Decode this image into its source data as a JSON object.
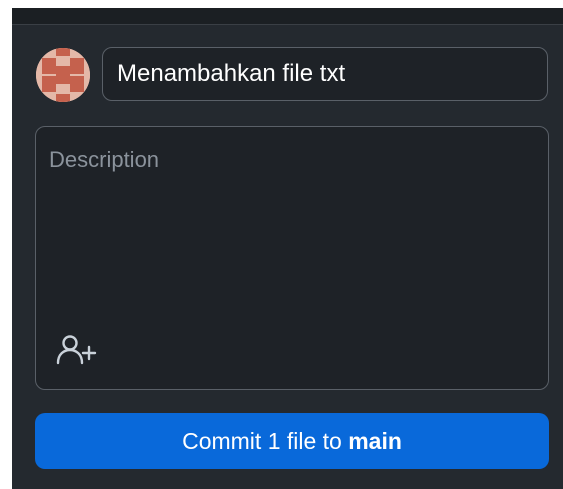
{
  "summary": {
    "value": "Menambahkan file txt"
  },
  "description": {
    "placeholder": "Description"
  },
  "commit_button": {
    "prefix": "Commit 1 file to ",
    "branch": "main"
  },
  "icons": {
    "avatar": "avatar-identicon",
    "coauthor": "person-add-icon"
  },
  "colors": {
    "panel_bg": "#24292f",
    "input_bg": "#1e2227",
    "border": "#5a6068",
    "primary": "#0969da",
    "placeholder": "#8b939c",
    "avatar_bg": "#e4b8a8",
    "avatar_fg": "#c5614d"
  }
}
